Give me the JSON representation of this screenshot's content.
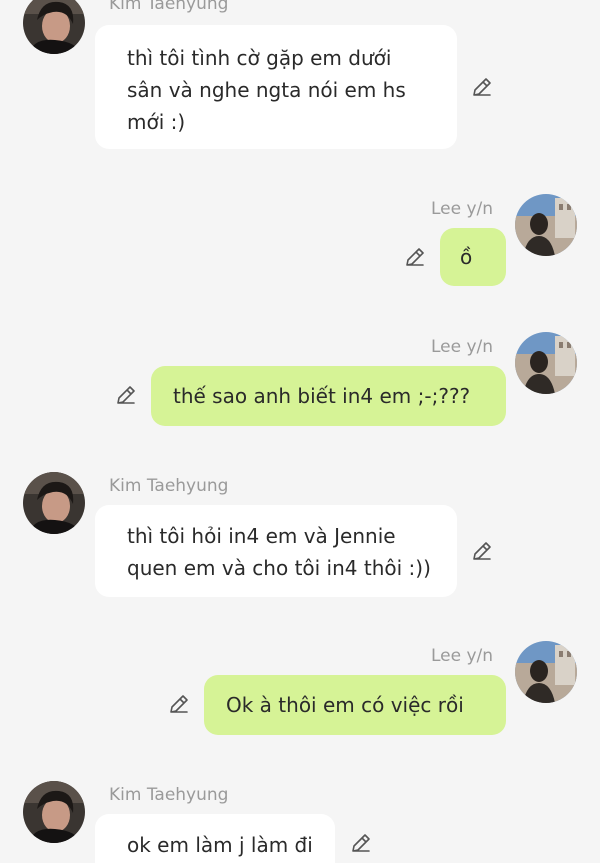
{
  "colors": {
    "background": "#f5f5f5",
    "bubble_left": "#ffffff",
    "bubble_right": "#d6f396",
    "sender_name": "#9a9a9a",
    "text": "#2a2a2a",
    "icon": "#555555"
  },
  "messages": [
    {
      "sender": "Kim Taehyung",
      "side": "left",
      "lines": [
        "thì tôi tình cờ gặp em dưới",
        "sân và nghe ngta nói em hs",
        "mới :)"
      ],
      "icon": "edit-icon"
    },
    {
      "sender": "Lee y/n",
      "side": "right",
      "lines": [
        "ồ"
      ],
      "icon": "edit-icon"
    },
    {
      "sender": "Lee y/n",
      "side": "right",
      "lines": [
        "thế sao anh biết in4 em ;-;???"
      ],
      "icon": "edit-icon"
    },
    {
      "sender": "Kim Taehyung",
      "side": "left",
      "lines": [
        "thì tôi hỏi in4 em và Jennie",
        "quen em và cho tôi in4 thôi :))"
      ],
      "icon": "edit-icon"
    },
    {
      "sender": "Lee y/n",
      "side": "right",
      "lines": [
        "Ok à thôi em có việc rồi"
      ],
      "icon": "edit-icon"
    },
    {
      "sender": "Kim Taehyung",
      "side": "left",
      "lines": [
        "ok em làm j làm đi"
      ],
      "icon": "edit-icon"
    }
  ]
}
